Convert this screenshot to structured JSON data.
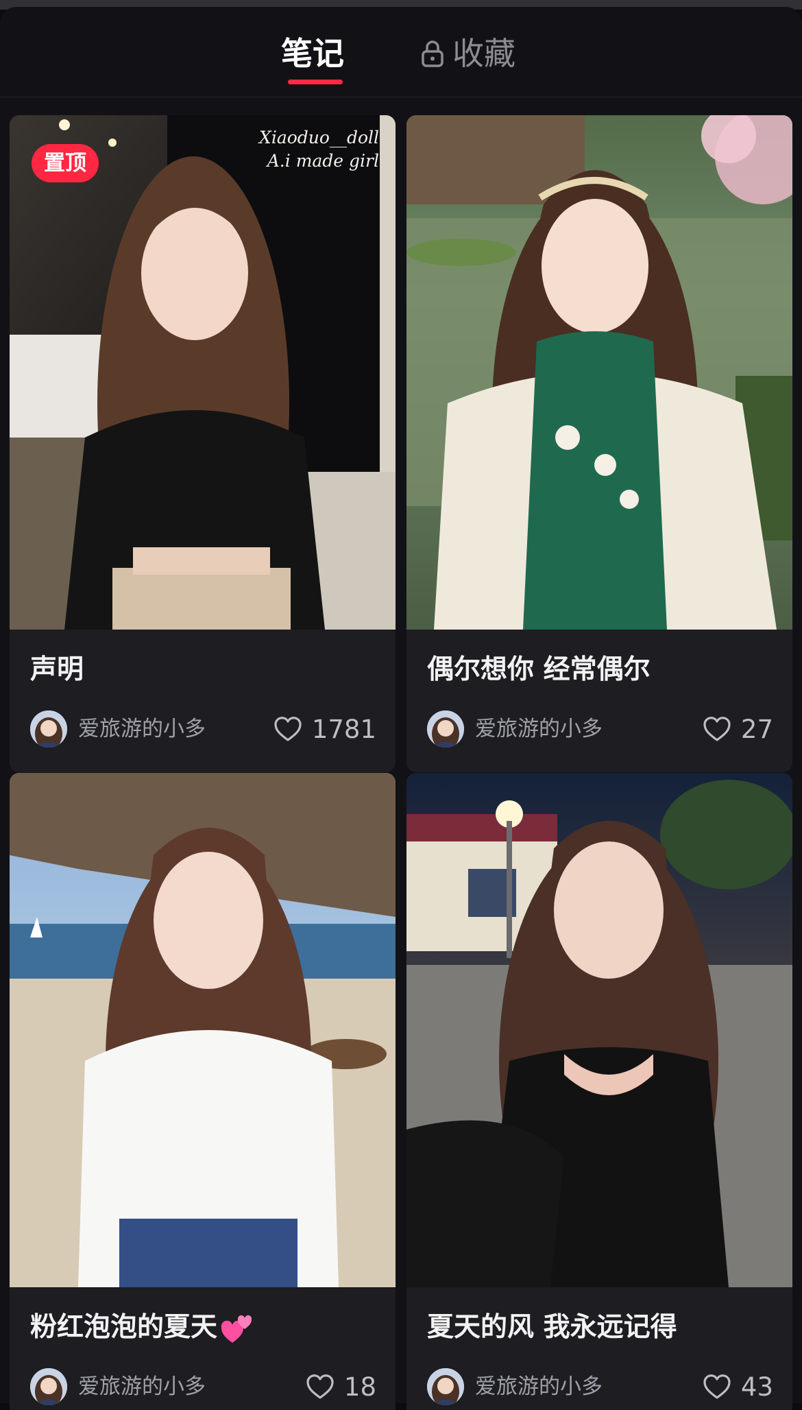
{
  "tabs": {
    "notes_label": "笔记",
    "collect_label": "收藏",
    "active": "notes"
  },
  "colors": {
    "accent": "#ff2a44",
    "background": "#121216",
    "card": "#1d1d22"
  },
  "cards": [
    {
      "title": "声明",
      "author": "爱旅游的小多",
      "likes": "1781",
      "pinned_label": "置顶",
      "watermark_line1": "Xiaoduo__doll",
      "watermark_line2": "A.i made girl"
    },
    {
      "title": "偶尔想你 经常偶尔",
      "author": "爱旅游的小多",
      "likes": "27"
    },
    {
      "title": "粉红泡泡的夏天",
      "title_emoji": "two-hearts",
      "author": "爱旅游的小多",
      "likes": "18"
    },
    {
      "title": "夏天的风 我永远记得",
      "author": "爱旅游的小多",
      "likes": "43"
    }
  ]
}
